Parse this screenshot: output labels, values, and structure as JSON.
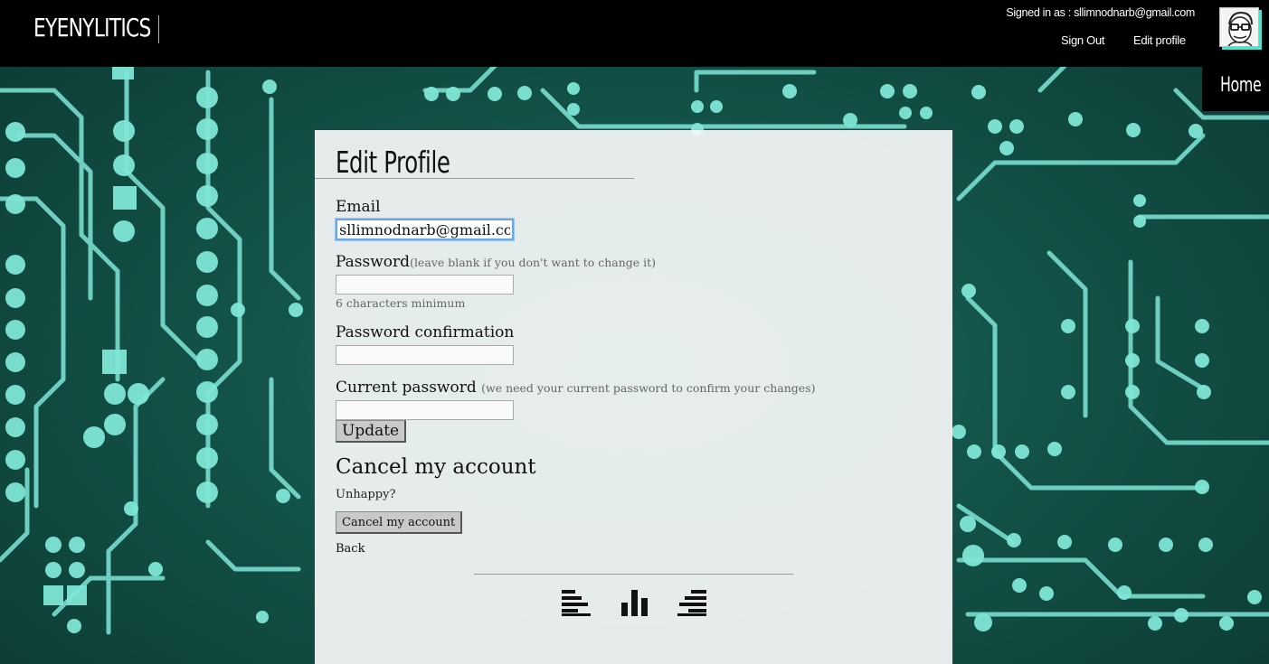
{
  "header": {
    "logo": "EYENYLITICS",
    "signed_in_text": "Signed in as : sllimnodnarb@gmail.com",
    "nav": {
      "sign_out": "Sign Out",
      "edit_profile": "Edit profile"
    },
    "home_label": "Home",
    "avatar_icon": "user-avatar-caricature"
  },
  "form": {
    "title": "Edit Profile",
    "email_label": "Email",
    "email_value": "sllimnodnarb@gmail.com",
    "password_label": "Password",
    "password_hint": "(leave blank if you don't want to change it)",
    "password_value": "",
    "password_min_hint": "6 characters minimum",
    "password_confirmation_label": "Password confirmation",
    "password_confirmation_value": "",
    "current_password_label": "Current password",
    "current_password_hint": "(we need your current password to confirm your changes)",
    "current_password_value": "",
    "update_button": "Update"
  },
  "cancel_section": {
    "heading": "Cancel my account",
    "unhappy_text": "Unhappy?",
    "cancel_button": "Cancel my account",
    "back_link": "Back"
  },
  "footer_icons": [
    "align-left-bars-icon",
    "bar-chart-icon",
    "align-right-bars-icon"
  ],
  "colors": {
    "accent": "#2bc7d8",
    "circuit": "#7fe6d6",
    "header_bg": "#000000",
    "panel_bg": "#f5f8f7"
  }
}
